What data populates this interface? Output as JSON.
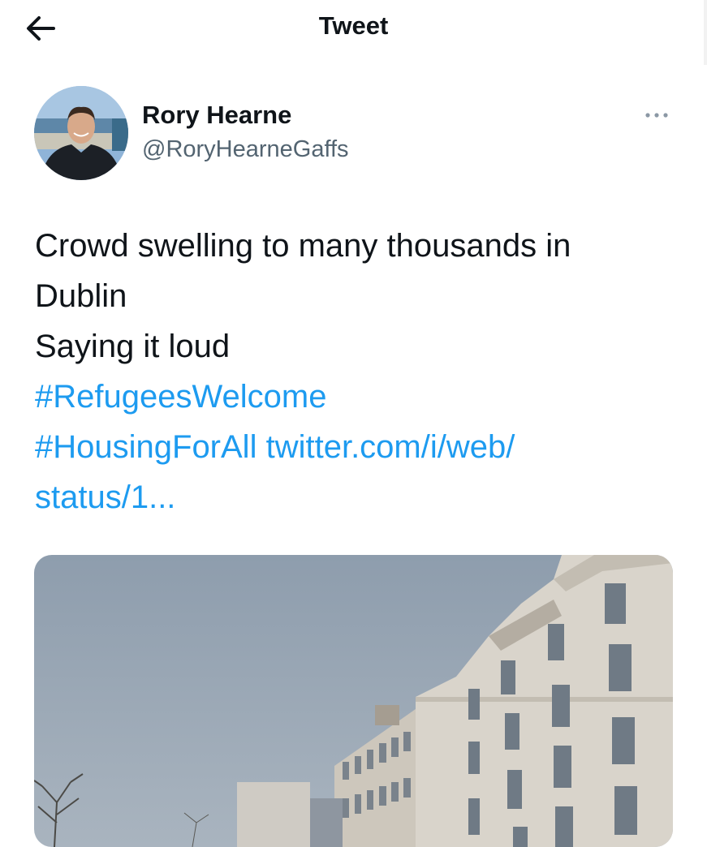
{
  "header": {
    "title": "Tweet"
  },
  "author": {
    "name": "Rory Hearne",
    "handle": "@RoryHearneGaffs"
  },
  "tweet": {
    "line1": "Crowd swelling to many thousands in",
    "line2": "Dublin",
    "line3": "Saying it loud",
    "hashtag1": "#RefugeesWelcome",
    "hashtag2": "#HousingForAll",
    "link_part1": "twitter.com/i/web/",
    "link_part2": "status/1..."
  },
  "colors": {
    "link": "#1d9bf0",
    "secondary_text": "#536471",
    "primary_text": "#0f1419"
  },
  "icons": {
    "back": "back-arrow-icon",
    "more": "more-horizontal-icon"
  }
}
